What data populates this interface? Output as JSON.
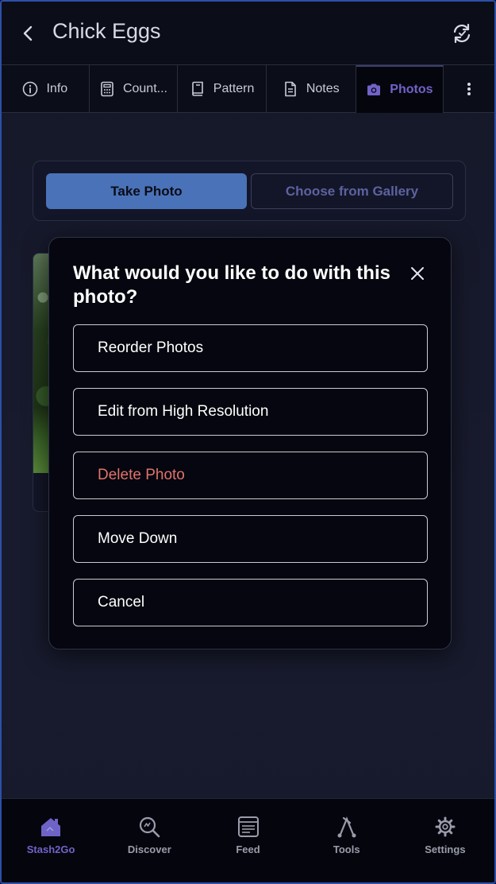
{
  "header": {
    "title": "Chick Eggs",
    "back_icon": "chevron-left-icon",
    "sync_icon": "sync-icon"
  },
  "tabs": [
    {
      "label": "Info",
      "icon": "info-icon",
      "active": false
    },
    {
      "label": "Count...",
      "icon": "calculator-icon",
      "active": false
    },
    {
      "label": "Pattern",
      "icon": "book-icon",
      "active": false
    },
    {
      "label": "Notes",
      "icon": "document-icon",
      "active": false
    },
    {
      "label": "Photos",
      "icon": "camera-icon",
      "active": true
    }
  ],
  "photo_actions": {
    "take_photo_label": "Take Photo",
    "gallery_label": "Choose from Gallery"
  },
  "modal": {
    "title": "What would you like to do with this photo?",
    "options": [
      {
        "label": "Reorder Photos"
      },
      {
        "label": "Edit from High Resolution"
      },
      {
        "label": "Delete Photo"
      },
      {
        "label": "Move Down"
      },
      {
        "label": "Cancel"
      }
    ]
  },
  "bottom_nav": [
    {
      "label": "Stash2Go",
      "icon": "house-icon",
      "active": true
    },
    {
      "label": "Discover",
      "icon": "search-icon",
      "active": false
    },
    {
      "label": "Feed",
      "icon": "feed-icon",
      "active": false
    },
    {
      "label": "Tools",
      "icon": "tools-icon",
      "active": false
    },
    {
      "label": "Settings",
      "icon": "gear-icon",
      "active": false
    }
  ],
  "colors": {
    "accent": "#6f63c8",
    "primary_button": "#4a72b8",
    "danger": "#e0736b",
    "background": "#151829"
  }
}
